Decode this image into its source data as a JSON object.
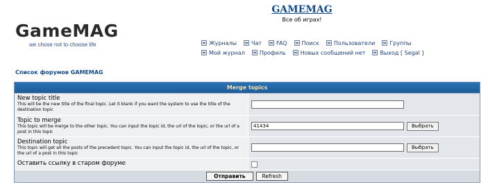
{
  "logo": {
    "title": "GameMAG",
    "tagline": "we chose not to choose life"
  },
  "site": {
    "name": "GAMEMAG",
    "slogan": "Все об играх!"
  },
  "nav": {
    "row1": [
      {
        "label": "Журналы",
        "icon": "journal-icon"
      },
      {
        "label": "Чат",
        "icon": "chat-icon"
      },
      {
        "label": "FAQ",
        "icon": "faq-icon"
      },
      {
        "label": "Поиск",
        "icon": "search-icon"
      },
      {
        "label": "Пользователи",
        "icon": "users-icon"
      },
      {
        "label": "Группы",
        "icon": "groups-icon"
      }
    ],
    "row2": [
      {
        "label": "Мой журнал",
        "icon": "my-journal-icon"
      },
      {
        "label": "Профиль",
        "icon": "profile-icon"
      },
      {
        "label": "Новых сообщений нет",
        "icon": "messages-icon"
      },
      {
        "label": "Выход [ Segal ]",
        "icon": "logout-icon"
      }
    ]
  },
  "breadcrumb": "Список форумов GAMEMAG",
  "form": {
    "header": "Merge topics",
    "new_title": {
      "label": "New topic title",
      "desc": "This will be the new title of the final topic. Let it blank if you want the system to use the title of the destination topic",
      "value": ""
    },
    "topic_to_merge": {
      "label": "Topic to merge",
      "desc": "This topic will be merge to the other topic. You can input the topic id, the url of the topic, or the url of a post in this topic",
      "value": "41434",
      "button": "Выбрать"
    },
    "destination": {
      "label": "Destination topic",
      "desc": "This topic will get all the posts of the precedent topic. You can input the topic id, the url of the topic, or the url of a post in this topic",
      "value": "",
      "button": "Выбрать"
    },
    "leave_link": {
      "label": "Оставить ссылку в старом форуме",
      "checked": false
    },
    "submit": "Отправить",
    "refresh": "Refresh"
  }
}
